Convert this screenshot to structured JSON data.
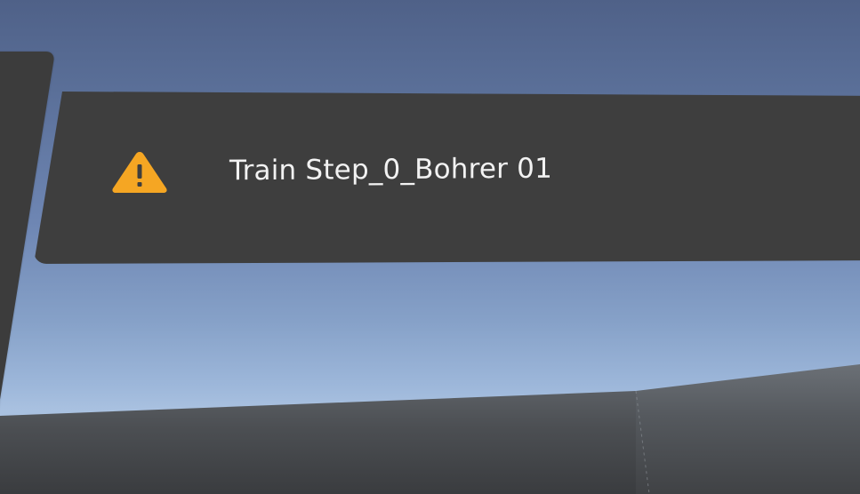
{
  "notification": {
    "message": "Train Step_0_Bohrer 01",
    "icon": "warning-triangle-icon",
    "icon_color": "#f5a623"
  },
  "colors": {
    "panel": "#3e3e3e",
    "text": "#f2f2f2",
    "sky_top": "#4f6188",
    "sky_bottom": "#a9c1e0"
  }
}
